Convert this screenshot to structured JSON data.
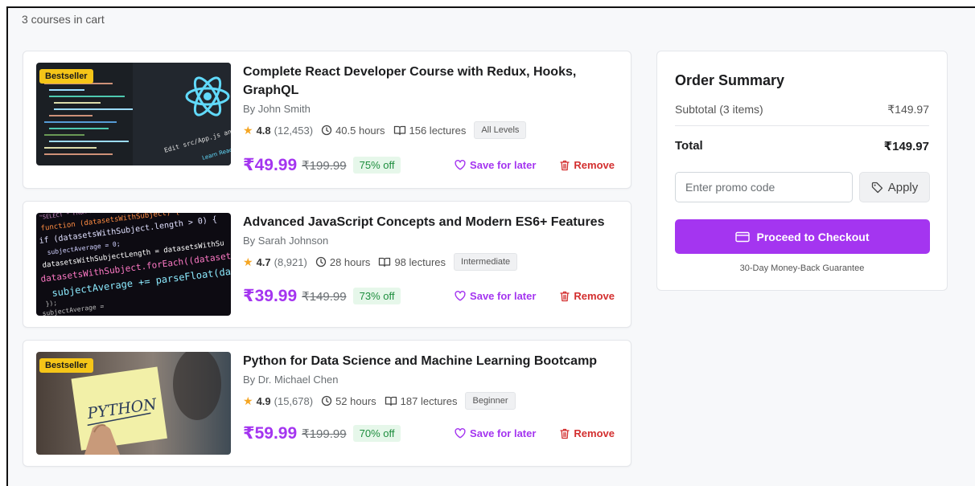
{
  "cart": {
    "count_text": "3 courses in cart"
  },
  "courses": [
    {
      "badge": "Bestseller",
      "title_line1": "Complete React Developer Course with Redux, Hooks,",
      "title_line2": "GraphQL",
      "author": "By John Smith",
      "rating": "4.8",
      "ratings_count": "(12,453)",
      "hours": "40.5 hours",
      "lectures": "156 lectures",
      "level": "All Levels",
      "price": "₹49.99",
      "original_price": "₹199.99",
      "discount": "75% off",
      "save_label": "Save for later",
      "remove_label": "Remove",
      "thumb_text": "Edit src/App.js and save to",
      "thumb_link": "Learn React"
    },
    {
      "badge": "",
      "title_line1": "Advanced JavaScript Concepts and Modern ES6+ Features",
      "title_line2": "",
      "author": "By Sarah Johnson",
      "rating": "4.7",
      "ratings_count": "(8,921)",
      "hours": "28 hours",
      "lectures": "98 lectures",
      "level": "Intermediate",
      "price": "₹39.99",
      "original_price": "₹149.99",
      "discount": "73% off",
      "save_label": "Save for later",
      "remove_label": "Remove",
      "code_lines": [
        "\"SELECT * FROM marks WHERE subject",
        "function (datasetsWithSubject) {",
        "if (datasetsWithSubject.length > 0) {",
        "subjectAverage = 0;",
        "datasetsWithSubjectLength = datasetsWithSu",
        "datasetsWithSubject.forEach((dataset) =>",
        "subjectAverage += parseFloat(dataset[",
        "});",
        "subjectAverage ="
      ]
    },
    {
      "badge": "Bestseller",
      "title_line1": "Python for Data Science and Machine Learning Bootcamp",
      "title_line2": "",
      "author": "By Dr. Michael Chen",
      "rating": "4.9",
      "ratings_count": "(15,678)",
      "hours": "52 hours",
      "lectures": "187 lectures",
      "level": "Beginner",
      "price": "₹59.99",
      "original_price": "₹199.99",
      "discount": "70% off",
      "save_label": "Save for later",
      "remove_label": "Remove",
      "note_text": "PYTHON"
    }
  ],
  "summary": {
    "title": "Order Summary",
    "subtotal_label": "Subtotal (3 items)",
    "subtotal_value": "₹149.97",
    "total_label": "Total",
    "total_value": "₹149.97",
    "promo_placeholder": "Enter promo code",
    "apply_label": "Apply",
    "checkout_label": "Proceed to Checkout",
    "guarantee": "30-Day Money-Back Guarantee"
  },
  "colors": {
    "accent": "#a435f0",
    "discount_bg": "#e6f7ea",
    "discount_text": "#1e8e3e",
    "remove": "#d32f2f",
    "badge": "#f5c518",
    "star": "#f5a623"
  },
  "icons": {
    "star": "star-icon",
    "clock": "clock-icon",
    "lectures": "book-open-icon",
    "save": "heart-icon",
    "remove": "trash-icon",
    "apply": "tag-icon",
    "checkout": "credit-card-icon"
  }
}
